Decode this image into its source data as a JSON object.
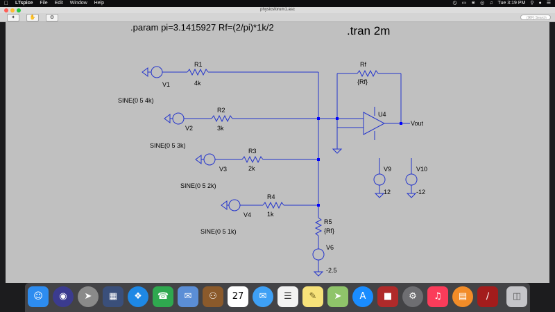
{
  "menubar": {
    "app": "LTspice",
    "items": [
      "File",
      "Edit",
      "Window",
      "Help"
    ],
    "clock": "Tue 3:19 PM"
  },
  "window": {
    "title": "physicsforum1.asc",
    "search_placeholder": "(⌘F) Search"
  },
  "toolbar": {
    "buttons": [
      {
        "name": "run-button",
        "icon": "running-man-icon"
      },
      {
        "name": "halt-button",
        "icon": "hand-icon"
      },
      {
        "name": "settings-button",
        "icon": "gear-icon"
      }
    ]
  },
  "schematic": {
    "directives": {
      "param": ".param pi=3.1415927 Rf=(2/pi)*1k/2",
      "tran": ".tran 2m"
    },
    "sources": [
      {
        "name": "V1",
        "value": ""
      },
      {
        "name": "V2",
        "value": "SINE(0 5 4k)"
      },
      {
        "name": "V3",
        "value": "SINE(0 5 3k)"
      },
      {
        "name": "V4",
        "value": "SINE(0 5 2k)"
      },
      {
        "name": "V9",
        "value": "12"
      },
      {
        "name": "V10",
        "value": "-12"
      },
      {
        "name": "V6",
        "value": "-2.5"
      }
    ],
    "v4_value": "SINE(0 5 1k)",
    "resistors": [
      {
        "name": "R1",
        "value": "4k"
      },
      {
        "name": "R2",
        "value": "3k"
      },
      {
        "name": "R3",
        "value": "2k"
      },
      {
        "name": "R4",
        "value": "1k"
      },
      {
        "name": "R5",
        "value": "{Rf}"
      },
      {
        "name": "Rf",
        "value": "{Rf}"
      }
    ],
    "opamp": "U4",
    "output_label": "Vout",
    "colors": {
      "wire": "#2233cc",
      "background": "#c0c0c0",
      "junction": "#0000ff"
    }
  },
  "dock": {
    "apps": [
      "Finder",
      "Siri",
      "Launchpad",
      "Calculator",
      "Safari",
      "FaceTime",
      "Mail",
      "Contacts",
      "Calendar",
      "Messages",
      "Reminders",
      "Notes",
      "Maps",
      "App Store",
      "Photo Booth",
      "System Preferences",
      "Music",
      "Books",
      "Parallels",
      "Trash"
    ],
    "calendar_day": "27"
  }
}
